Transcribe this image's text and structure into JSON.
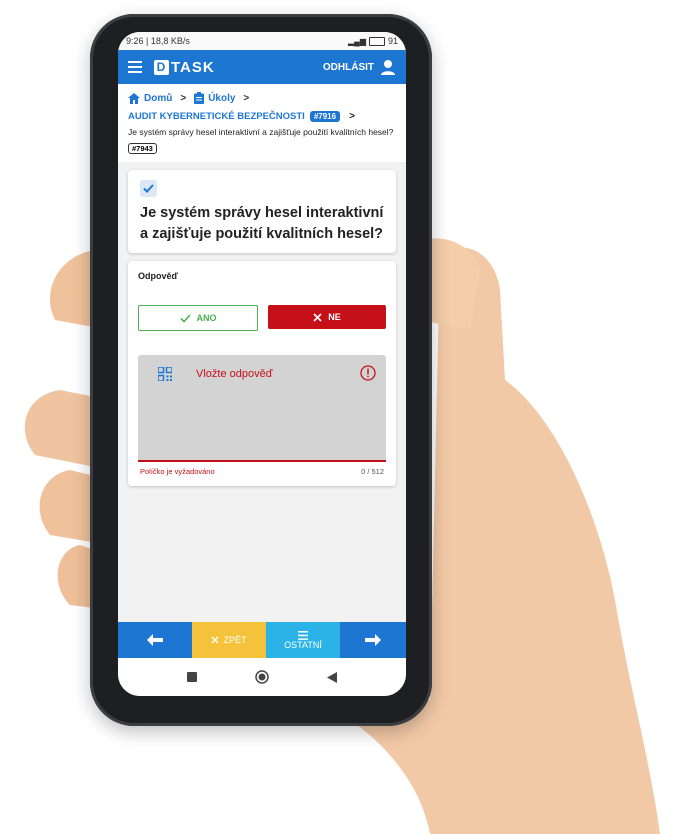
{
  "status": {
    "time_speed": "9:26 | 18,8 KB/s",
    "battery": "91"
  },
  "appbar": {
    "logo_letter": "D",
    "logo_text": "TASK",
    "logout_label": "ODHLÁSIT"
  },
  "breadcrumb": {
    "home": "Domů",
    "tasks": "Úkoly"
  },
  "audit": {
    "title": "AUDIT KYBERNETICKÉ BEZPEČNOSTI",
    "id": "#7916"
  },
  "question_header": {
    "text": "Je systém správy hesel interaktivní a zajišťuje použití kvalitních hesel?",
    "id": "#7943"
  },
  "question_card": {
    "title": "Je systém správy hesel interaktivní a zajišťuje použití kvalitních hesel?"
  },
  "answer": {
    "label": "Odpověď",
    "yes_label": "ANO",
    "no_label": "NE",
    "placeholder": "Vložte odpověď",
    "error_text": "Políčko je vyžadováno",
    "counter": "0 / 512"
  },
  "bottom": {
    "back_label": "ZPĚT",
    "other_label": "OSTATNÍ"
  },
  "colors": {
    "primary": "#1e76d3",
    "error": "#c5101a",
    "success": "#4caf50",
    "warning": "#f5c23c",
    "info": "#2bb3e8"
  }
}
